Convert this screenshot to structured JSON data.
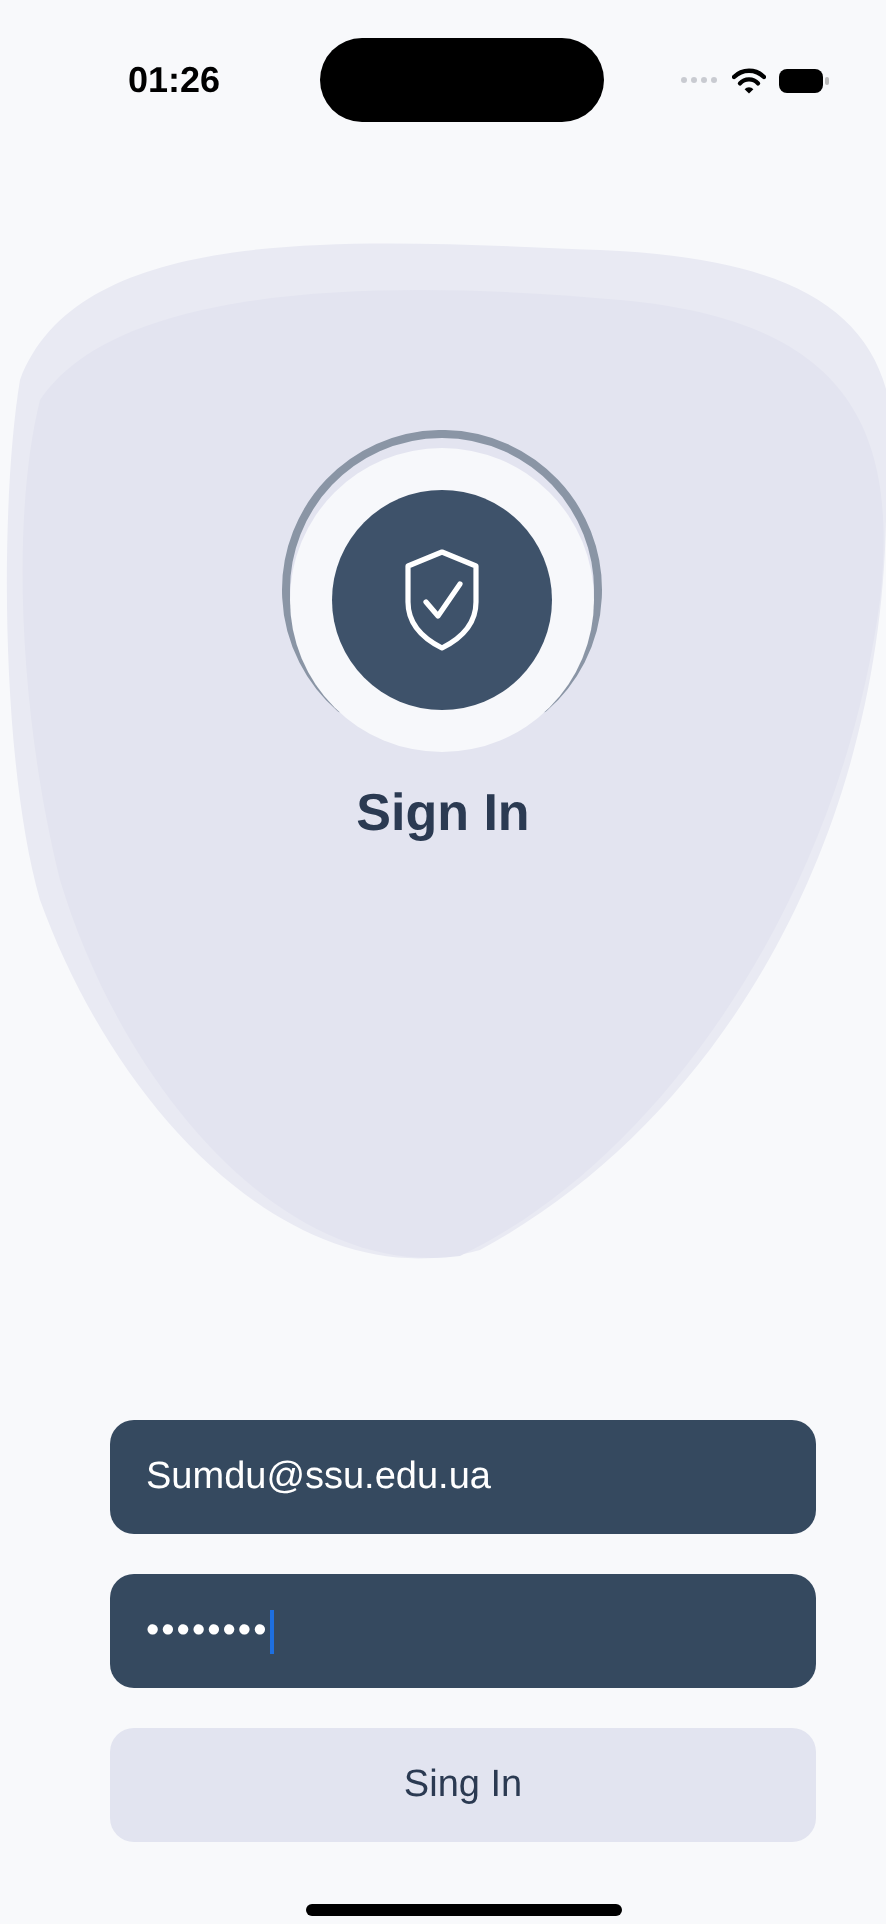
{
  "status_bar": {
    "time": "01:26"
  },
  "title": "Sign In",
  "fields": [
    {
      "kind": "email",
      "value": "Sumdu@ssu.edu.ua"
    },
    {
      "kind": "password",
      "value": "••••••••"
    }
  ],
  "submit_button": {
    "label": "Sing In"
  }
}
